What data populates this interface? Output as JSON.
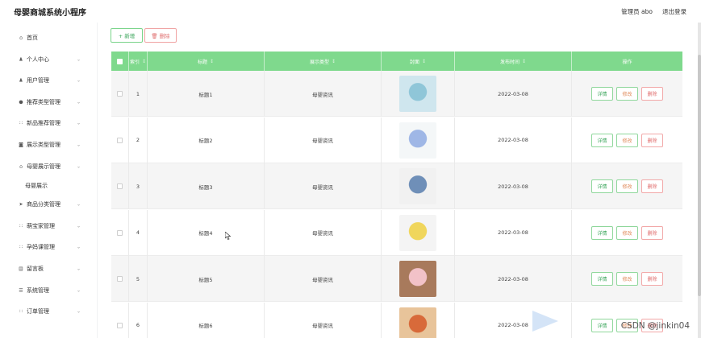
{
  "header": {
    "app_title": "母婴商城系统小程序",
    "user_label": "管理员 abo",
    "logout_label": "退出登录"
  },
  "sidebar": {
    "items": [
      {
        "label": "首页",
        "icon": "home-icon",
        "glyph": "⌂",
        "expandable": false
      },
      {
        "label": "个人中心",
        "icon": "user-icon",
        "glyph": "♟",
        "expandable": true
      },
      {
        "label": "用户管理",
        "icon": "user-icon",
        "glyph": "♟",
        "expandable": true
      },
      {
        "label": "推荐类型管理",
        "icon": "pin-icon",
        "glyph": "●",
        "expandable": true
      },
      {
        "label": "新品推荐管理",
        "icon": "grid-icon",
        "glyph": "∷",
        "expandable": true
      },
      {
        "label": "展示类型管理",
        "icon": "layers-icon",
        "glyph": "◙",
        "expandable": true
      },
      {
        "label": "母婴展示管理",
        "icon": "bank-icon",
        "glyph": "⌂",
        "expandable": true
      },
      {
        "label": "母婴展示",
        "icon": "",
        "glyph": "",
        "expandable": false,
        "sub": true
      },
      {
        "label": "商品分类管理",
        "icon": "send-icon",
        "glyph": "➤",
        "expandable": true
      },
      {
        "label": "萌宝家管理",
        "icon": "grid-icon",
        "glyph": "∷",
        "expandable": true
      },
      {
        "label": "孕妈课管理",
        "icon": "grid-icon",
        "glyph": "∷",
        "expandable": true
      },
      {
        "label": "留言板",
        "icon": "message-icon",
        "glyph": "▤",
        "expandable": true
      },
      {
        "label": "系统管理",
        "icon": "settings-icon",
        "glyph": "☰",
        "expandable": true
      },
      {
        "label": "订单管理",
        "icon": "grid-icon",
        "glyph": "∷",
        "expandable": true
      }
    ]
  },
  "toolbar": {
    "add_label": "+ 新增",
    "delete_label": "🗑 删除"
  },
  "table": {
    "columns": [
      "索引",
      "标题",
      "展示类型",
      "封面",
      "发布时间",
      "操作"
    ],
    "sort_glyph": "↕",
    "rows": [
      {
        "index": "1",
        "title": "标题1",
        "type": "母婴资讯",
        "date": "2022-03-08",
        "cover_color": "#cfe6ee",
        "cover_accent": "#8fc6d8"
      },
      {
        "index": "2",
        "title": "标题2",
        "type": "母婴资讯",
        "date": "2022-03-08",
        "cover_color": "#f4f7f8",
        "cover_accent": "#9fb7e6"
      },
      {
        "index": "3",
        "title": "标题3",
        "type": "母婴资讯",
        "date": "2022-03-08",
        "cover_color": "#f1f1f1",
        "cover_accent": "#6f8fb8"
      },
      {
        "index": "4",
        "title": "标题4",
        "type": "母婴资讯",
        "date": "2022-03-08",
        "cover_color": "#f4f4f4",
        "cover_accent": "#f0d65c"
      },
      {
        "index": "5",
        "title": "标题5",
        "type": "母婴资讯",
        "date": "2022-03-08",
        "cover_color": "#a87a5c",
        "cover_accent": "#f2c2c8"
      },
      {
        "index": "6",
        "title": "标题6",
        "type": "母婴资讯",
        "date": "2022-03-08",
        "cover_color": "#e8c49a",
        "cover_accent": "#d86a3a"
      }
    ],
    "actions": {
      "detail": "详情",
      "edit": "修改",
      "delete": "删除"
    }
  },
  "watermark": "CSDN @jinkin04",
  "colors": {
    "header_green": "#7fd98d",
    "add_green": "#3aa55a",
    "delete_red": "#e07070"
  }
}
